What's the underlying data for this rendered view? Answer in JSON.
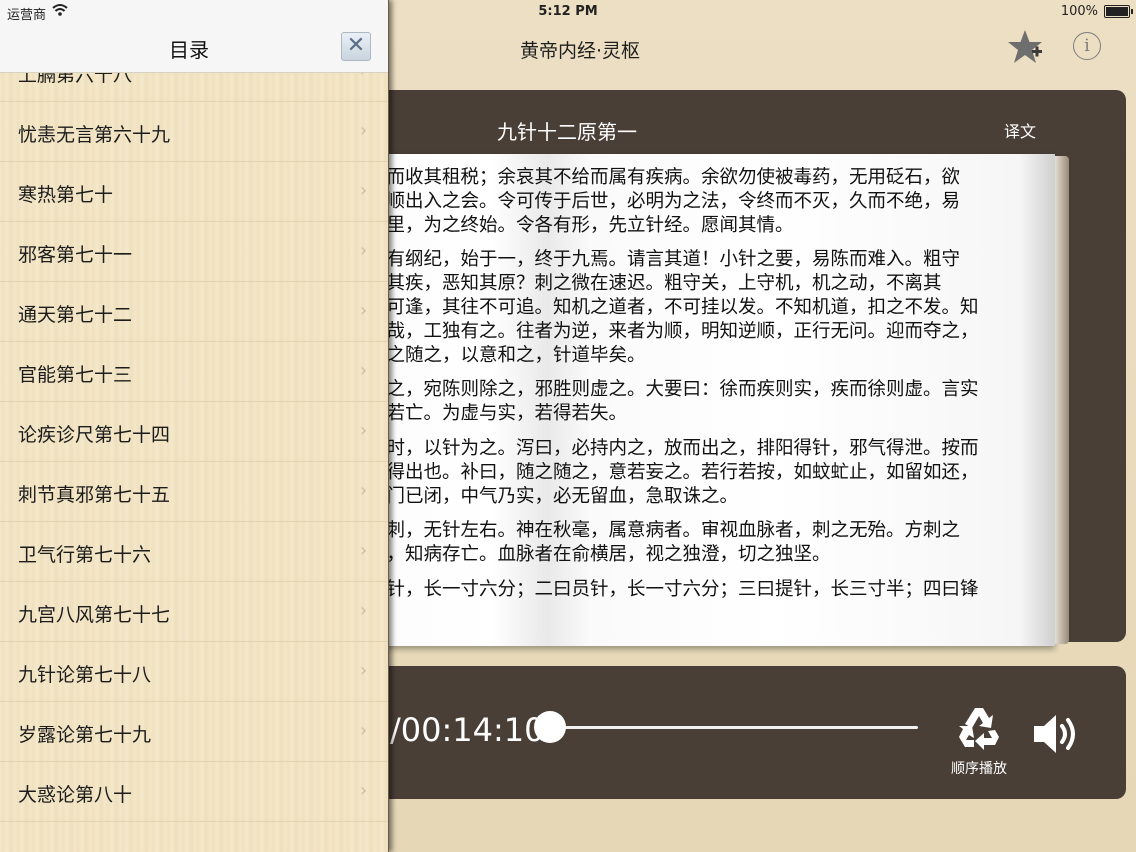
{
  "status_bar": {
    "carrier": "运营商",
    "time": "5:12 PM",
    "battery": "100%"
  },
  "nav": {
    "title": "黄帝内经·灵枢",
    "favorite_icon": "star-plus-icon",
    "info_icon": "info-icon",
    "info_glyph": "i"
  },
  "chapter": {
    "title": "九针十二原第一",
    "translate_label": "译文",
    "paragraphs": [
      "姓而收其租税；余哀其不给而属有疾病。余欲勿使被毒药，无用砭石，欲\n逆顺出入之会。令可传于后世，必明为之法，令终而不灭，久而不绝，易\n表里，为之终始。令各有形，先立针经。愿闻其情。",
      "令有纲纪，始于一，终于九焉。请言其道！小针之要，易陈而难入。粗守\n赫其疾，恶知其原？刺之微在速迟。粗守关，上守机，机之动，不离其\n不可逢，其往不可追。知机之道者，不可挂以发。不知机道，扣之不发。知\n乎哉，工独有之。往者为逆，来者为顺，明知逆顺，正行无问。迎而夺之，\n迎之随之，以意和之，针道毕矣。",
      "泄之，宛陈则除之，邪胜则虚之。大要曰：徐而疾则实，疾而徐则虚。言实\n乎若亡。为虚与实，若得若失。",
      "之时，以针为之。泻曰，必持内之，放而出之，排阳得针，邪气得泄。按而\n不得出也。补曰，随之随之，意若妄之。若行若按，如蚊虻止，如留如还，\n外门已闭，中气乃实，必无留血，急取诛之。",
      "直刺，无针左右。神在秋毫，属意病者。审视血脉者，刺之无殆。方刺之\n去，知病存亡。血脉者在俞横居，视之独澄，切之独坚。",
      "镵针，长一寸六分；二曰员针，长一寸六分；三曰提针，长三寸半；四曰锋"
    ]
  },
  "player": {
    "time": "/00:14:10",
    "progress": 0.0,
    "mode_label": "顺序播放",
    "mode_icon": "recycle-icon",
    "volume_icon": "speaker-icon"
  },
  "toc": {
    "title": "目录",
    "close_glyph": "✕",
    "items": [
      "上膈第六十八",
      "忧恚无言第六十九",
      "寒热第七十",
      "邪客第七十一",
      "通天第七十二",
      "官能第七十三",
      "论疾诊尺第七十四",
      "刺节真邪第七十五",
      "卫气行第七十六",
      "九宫八风第七十七",
      "九针论第七十八",
      "岁露论第七十九",
      "大惑论第八十"
    ],
    "chevron": "›"
  }
}
